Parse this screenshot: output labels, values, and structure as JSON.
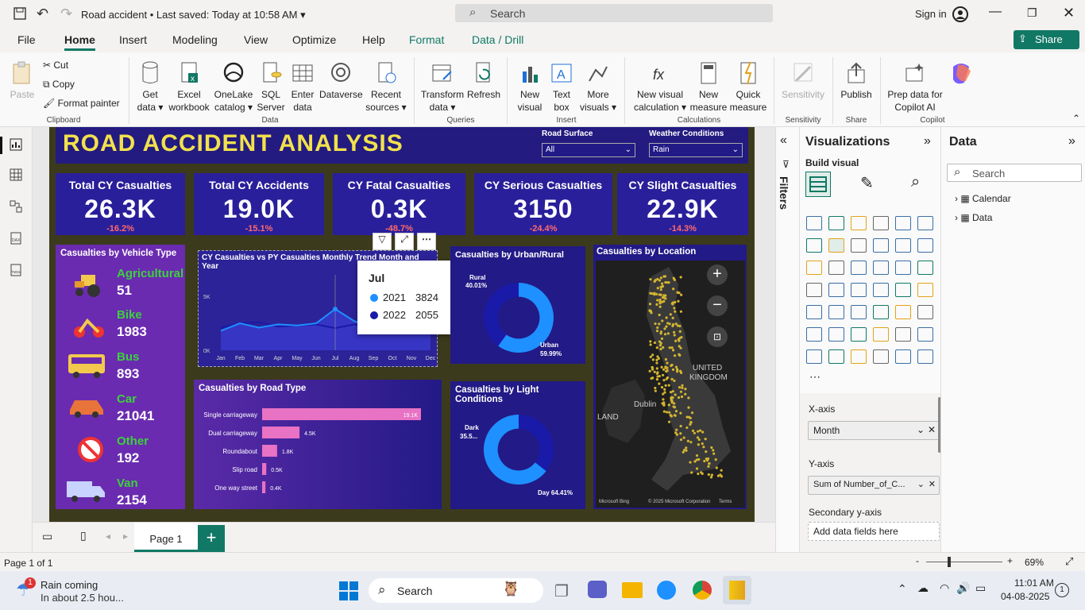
{
  "window": {
    "title": "Road accident",
    "saved": "Last saved: Today at 10:58 AM",
    "search": "Search",
    "signin": "Sign in"
  },
  "tabs": [
    "File",
    "Home",
    "Insert",
    "Modeling",
    "View",
    "Optimize",
    "Help",
    "Format",
    "Data / Drill"
  ],
  "share": "Share",
  "ribbon": {
    "paste": "Paste",
    "cut": "Cut",
    "copy": "Copy",
    "format_painter": "Format painter",
    "get_data": "Get data",
    "excel": "Excel workbook",
    "onelake": "OneLake catalog",
    "sql": "SQL Server",
    "enter": "Enter data",
    "dataverse": "Dataverse",
    "recent": "Recent sources",
    "transform": "Transform data",
    "refresh": "Refresh",
    "new_visual": "New visual",
    "text_box": "Text box",
    "more_visuals": "More visuals",
    "new_visual_calc": "New visual calculation",
    "new_measure": "New measure",
    "quick_measure": "Quick measure",
    "sensitivity": "Sensitivity",
    "publish": "Publish",
    "copilot": "Prep data for Copilot AI",
    "groups": [
      "Clipboard",
      "Data",
      "Queries",
      "Insert",
      "Calculations",
      "Sensitivity",
      "Share",
      "Copilot"
    ]
  },
  "report": {
    "title": "ROAD ACCIDENT ANALYSIS",
    "slicer1": {
      "label": "Road Surface",
      "value": "All"
    },
    "slicer2": {
      "label": "Weather Conditions",
      "value": "Rain"
    },
    "cards": [
      {
        "title": "Total CY Casualties",
        "value": "26.3K",
        "delta": "-16.2%"
      },
      {
        "title": "Total CY Accidents",
        "value": "19.0K",
        "delta": "-15.1%"
      },
      {
        "title": "CY Fatal Casualties",
        "value": "0.3K",
        "delta": "-48.7%"
      },
      {
        "title": "CY Serious Casualties",
        "value": "3150",
        "delta": "-24.4%"
      },
      {
        "title": "CY Slight Casualties",
        "value": "22.9K",
        "delta": "-14.3%"
      }
    ],
    "vehicle_title": "Casualties by Vehicle Type",
    "vehicles": [
      {
        "name": "Agricultural",
        "value": "51"
      },
      {
        "name": "Bike",
        "value": "1983"
      },
      {
        "name": "Bus",
        "value": "893"
      },
      {
        "name": "Car",
        "value": "21041"
      },
      {
        "name": "Other",
        "value": "192"
      },
      {
        "name": "Van",
        "value": "2154"
      }
    ],
    "trend_title": "CY Casualties vs PY Casualties Monthly Trend Month and Year",
    "tooltip": {
      "month": "Jul",
      "rows": [
        {
          "year": "2021",
          "value": "3824",
          "color": "#1e90ff"
        },
        {
          "year": "2022",
          "value": "2055",
          "color": "#1a1aa8"
        }
      ]
    },
    "urban_title": "Casualties by Urban/Rural",
    "urban_labels": {
      "rural": "Rural",
      "rural_pct": "40.01%",
      "urban": "Urban",
      "urban_pct": "59.99%"
    },
    "road_title": "Casualties by Road Type",
    "light_title": "Casualties by Light Conditions",
    "light_labels": {
      "dark": "Dark",
      "dark_val": "35.5...",
      "day": "Day 64.41%"
    },
    "location_title": "Casualties by Location",
    "map_labels": {
      "uk": "UNITED",
      "kingdom": "KINGDOM",
      "dublin": "Dublin",
      "land": "LAND",
      "bing": "Microsoft Bing",
      "copy": "© 2025 Microsoft Corporation",
      "terms": "Terms"
    }
  },
  "chart_data": [
    {
      "type": "area",
      "title": "CY Casualties vs PY Casualties Monthly Trend Month and Year",
      "categories": [
        "Jan",
        "Feb",
        "Mar",
        "Apr",
        "May",
        "Jun",
        "Jul",
        "Aug",
        "Sep",
        "Oct",
        "Nov",
        "Dec"
      ],
      "y_ticks": [
        "0K",
        "5K"
      ],
      "ylim": [
        0,
        7000
      ],
      "series": [
        {
          "name": "2021",
          "values": [
            1800,
            2500,
            2100,
            2400,
            2300,
            2500,
            3824,
            2700,
            2200,
            2500,
            2400,
            2600
          ]
        },
        {
          "name": "2022",
          "values": [
            2100,
            2500,
            2600,
            2200,
            2300,
            2400,
            2055,
            2400,
            2200,
            2300,
            2200,
            2300
          ]
        }
      ]
    },
    {
      "type": "bar",
      "title": "Casualties by Road Type",
      "categories": [
        "Single carriageway",
        "Dual carriageway",
        "Roundabout",
        "Slip road",
        "One way street"
      ],
      "values": [
        19100,
        4500,
        1800,
        500,
        400
      ],
      "labels": [
        "19.1K",
        "4.5K",
        "1.8K",
        "0.5K",
        "0.4K"
      ]
    },
    {
      "type": "pie",
      "title": "Casualties by Urban/Rural",
      "categories": [
        "Rural",
        "Urban"
      ],
      "values": [
        40.01,
        59.99
      ]
    },
    {
      "type": "pie",
      "title": "Casualties by Light Conditions",
      "categories": [
        "Dark",
        "Day"
      ],
      "values": [
        35.59,
        64.41
      ]
    }
  ],
  "filters_label": "Filters",
  "viz": {
    "title": "Visualizations",
    "build": "Build visual",
    "xaxis": "X-axis",
    "xfield": "Month",
    "yaxis": "Y-axis",
    "yfield": "Sum of Number_of_C...",
    "secondary": "Secondary y-axis",
    "add": "Add data fields here"
  },
  "datapanel": {
    "title": "Data",
    "search": "Search",
    "items": [
      "Calendar",
      "Data"
    ]
  },
  "page": {
    "tab": "Page 1",
    "status": "Page 1 of 1",
    "zoom": "69%"
  },
  "taskbar": {
    "weather_title": "Rain coming",
    "weather_sub": "In about 2.5 hou...",
    "search": "Search",
    "time": "11:01 AM",
    "date": "04-08-2025",
    "badge": "1"
  }
}
